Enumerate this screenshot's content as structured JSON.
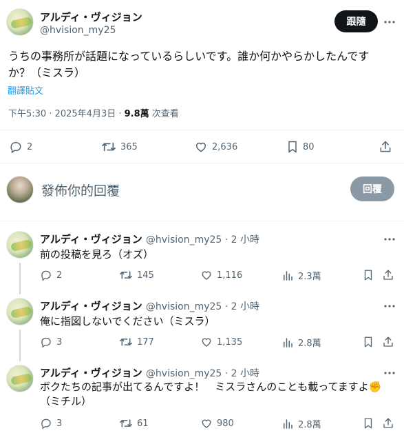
{
  "main_post": {
    "display_name": "アルディ・ヴィジョン",
    "handle": "@hvision_my25",
    "follow_label": "跟隨",
    "text": "うちの事務所が話題になっているらしいです。誰か何かやらかしたんです か？（ミスラ）",
    "text_line1": "うちの事務所が話題になっているらしいです。誰か何かやらかしたんです",
    "text_line2": "か？（ミスラ）",
    "translate_label": "翻譯貼文",
    "time": "下午5:30 · 2025年4月3日 · ",
    "views_count": "9.8萬",
    "views_label": " 次查看",
    "replies": "2",
    "reposts": "365",
    "likes": "2,636",
    "bookmarks": "80"
  },
  "compose": {
    "placeholder": "發佈你的回覆",
    "reply_label": "回覆"
  },
  "replies": [
    {
      "display_name": "アルディ・ヴィジョン",
      "meta": "@hvision_my25 · 2 小時",
      "text": "前の投稿を見ろ（オズ）",
      "replies": "2",
      "reposts": "145",
      "likes": "1,116",
      "views": "2.3萬"
    },
    {
      "display_name": "アルディ・ヴィジョン",
      "meta": "@hvision_my25 · 2 小時",
      "text": "俺に指図しないでください（ミスラ）",
      "replies": "3",
      "reposts": "177",
      "likes": "1,135",
      "views": "2.8萬"
    },
    {
      "display_name": "アルディ・ヴィジョン",
      "meta": "@hvision_my25 · 2 小時",
      "text_line1": "ボクたちの記事が出てるんですよ！　ミスラさんのことも載ってますよ",
      "emoji": "✊",
      "text_line2": "（ミチル）",
      "replies": "3",
      "reposts": "61",
      "likes": "980",
      "views": "2.8萬"
    }
  ],
  "colors": {
    "text": "#0f1419",
    "muted": "#536471",
    "link": "#1d9bf0",
    "follow_bg": "#0f1419",
    "reply_btn_bg": "#8b98a5",
    "divider": "#eff3f4"
  }
}
